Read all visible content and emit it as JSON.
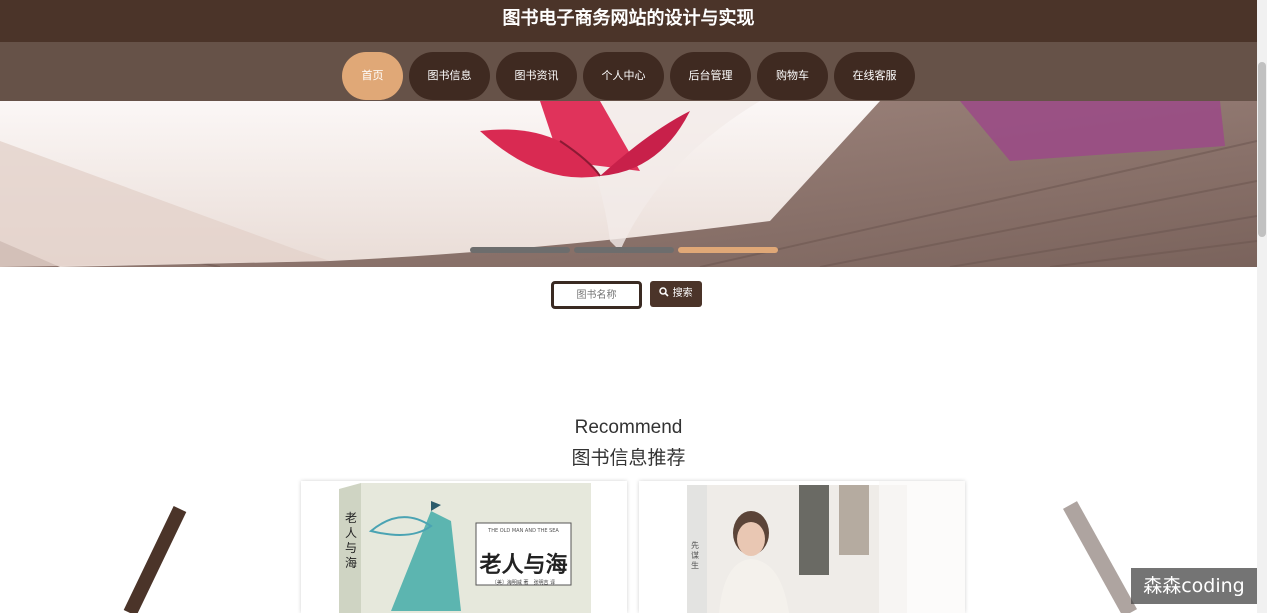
{
  "header": {
    "site_title": "图书电子商务网站的设计与实现"
  },
  "nav": {
    "items": [
      {
        "label": "首页",
        "active": true
      },
      {
        "label": "图书信息",
        "active": false
      },
      {
        "label": "图书资讯",
        "active": false
      },
      {
        "label": "个人中心",
        "active": false
      },
      {
        "label": "后台管理",
        "active": false
      },
      {
        "label": "购物车",
        "active": false
      },
      {
        "label": "在线客服",
        "active": false
      }
    ]
  },
  "carousel": {
    "slide_count": 3,
    "active_index": 2
  },
  "search": {
    "placeholder": "图书名称",
    "button_label": "搜索"
  },
  "recommend": {
    "title_en": "Recommend",
    "title_cn": "图书信息推荐",
    "books": [
      {
        "cover_title": "老人与海",
        "spine_title": "老人与海",
        "cover_en": "THE OLD MAN AND THE SEA",
        "author_line": "〔美〕海明威 著　张明吉 译"
      },
      {
        "cover_title": "",
        "spine_title": "先谋生",
        "cover_en": "",
        "author_line": ""
      }
    ]
  },
  "watermark": {
    "text": "森森coding"
  },
  "colors": {
    "primary": "#4b3429",
    "accent": "#e0a877",
    "nav_band": "#665248"
  }
}
